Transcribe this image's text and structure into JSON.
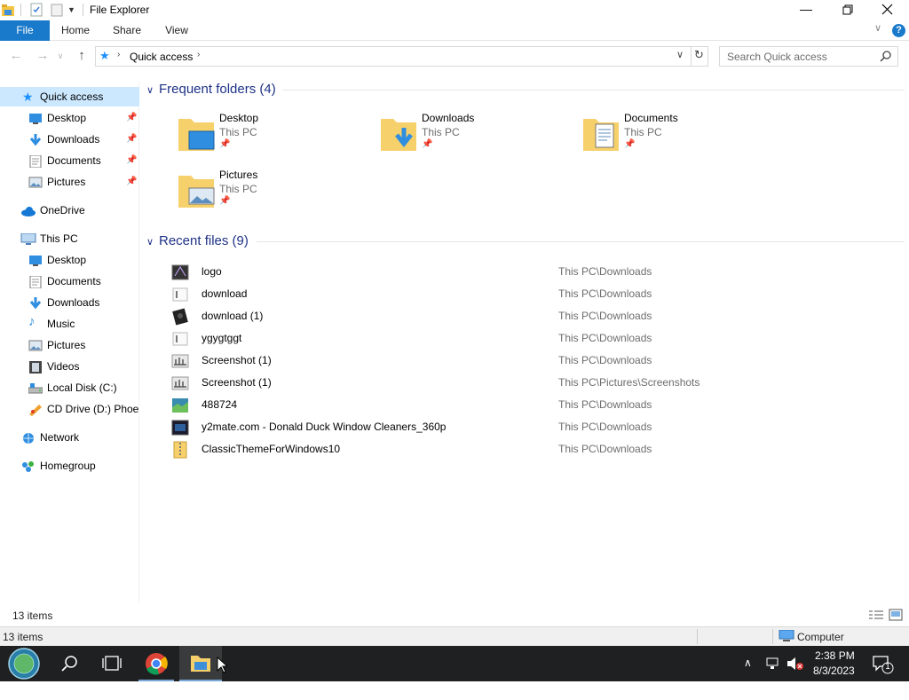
{
  "window": {
    "title": "File Explorer"
  },
  "ribbon": {
    "tabs": [
      "File",
      "Home",
      "Share",
      "View"
    ]
  },
  "address": {
    "location": "Quick access",
    "search_placeholder": "Search Quick access"
  },
  "sidebar": {
    "quick_access": {
      "label": "Quick access"
    },
    "quick_items": [
      {
        "label": "Desktop",
        "icon": "desktop-icon"
      },
      {
        "label": "Downloads",
        "icon": "downloads-icon"
      },
      {
        "label": "Documents",
        "icon": "documents-icon"
      },
      {
        "label": "Pictures",
        "icon": "pictures-icon"
      }
    ],
    "onedrive": {
      "label": "OneDrive"
    },
    "thispc": {
      "label": "This PC"
    },
    "pc_items": [
      {
        "label": "Desktop",
        "icon": "desktop-icon"
      },
      {
        "label": "Documents",
        "icon": "documents-icon"
      },
      {
        "label": "Downloads",
        "icon": "downloads-icon"
      },
      {
        "label": "Music",
        "icon": "music-icon"
      },
      {
        "label": "Pictures",
        "icon": "pictures-icon"
      },
      {
        "label": "Videos",
        "icon": "videos-icon"
      },
      {
        "label": "Local Disk (C:)",
        "icon": "local-disk-icon"
      },
      {
        "label": "CD Drive (D:) Phoer",
        "icon": "cd-drive-icon"
      }
    ],
    "network": {
      "label": "Network"
    },
    "homegroup": {
      "label": "Homegroup"
    }
  },
  "frequent": {
    "header": "Frequent folders (4)",
    "folders": [
      {
        "name": "Desktop",
        "location": "This PC",
        "icon": "desktop-folder-icon"
      },
      {
        "name": "Downloads",
        "location": "This PC",
        "icon": "downloads-folder-icon"
      },
      {
        "name": "Documents",
        "location": "This PC",
        "icon": "documents-folder-icon"
      },
      {
        "name": "Pictures",
        "location": "This PC",
        "icon": "pictures-folder-icon"
      }
    ]
  },
  "recent": {
    "header": "Recent files (9)",
    "files": [
      {
        "name": "logo",
        "path": "This PC\\Downloads",
        "icon": "image-file-icon"
      },
      {
        "name": "download",
        "path": "This PC\\Downloads",
        "icon": "blank-file-icon"
      },
      {
        "name": "download (1)",
        "path": "This PC\\Downloads",
        "icon": "image-file-icon"
      },
      {
        "name": "ygygtggt",
        "path": "This PC\\Downloads",
        "icon": "blank-file-icon"
      },
      {
        "name": "Screenshot (1)",
        "path": "This PC\\Downloads",
        "icon": "screenshot-file-icon"
      },
      {
        "name": "Screenshot (1)",
        "path": "This PC\\Pictures\\Screenshots",
        "icon": "screenshot-file-icon"
      },
      {
        "name": "488724",
        "path": "This PC\\Downloads",
        "icon": "image-file-icon"
      },
      {
        "name": "y2mate.com - Donald Duck Window Cleaners_360p",
        "path": "This PC\\Downloads",
        "icon": "video-file-icon"
      },
      {
        "name": "ClassicThemeForWindows10",
        "path": "This PC\\Downloads",
        "icon": "zip-file-icon"
      }
    ]
  },
  "status": {
    "items": "13 items",
    "bottom_items": "13 items",
    "location": "Computer"
  },
  "taskbar": {
    "time": "2:38 PM",
    "date": "8/3/2023",
    "notifications": "1"
  },
  "colors": {
    "accent": "#1979ca",
    "selection": "#cce8ff",
    "group_header": "#1e3287",
    "taskbar": "#1f2021"
  }
}
